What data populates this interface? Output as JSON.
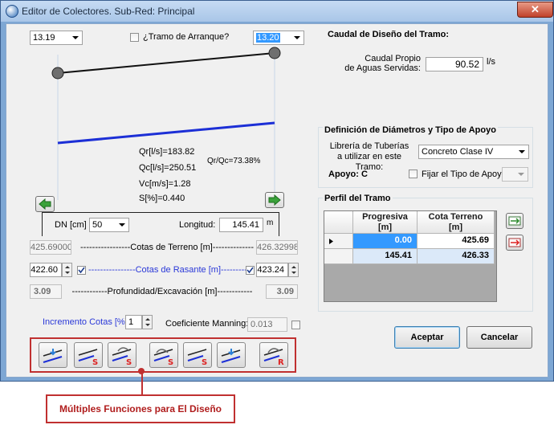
{
  "window": {
    "title": "Editor de Colectores. Sub-Red: Principal",
    "close_glyph": "✕"
  },
  "left": {
    "node_start": "13.19",
    "node_end": "13.20",
    "tramo_arranque_label": "¿Tramo de Arranque?",
    "metrics": {
      "qr": "Qr[l/s]=183.82",
      "qc": "Qc[l/s]=250.51",
      "vc": "Vc[m/s]=1.28",
      "s": "S[%]=0.440",
      "ratio": "Qr/Qc=73.38%"
    },
    "dn_label": "DN [cm]",
    "dn_value": "50",
    "longitud_label": "Longitud:",
    "longitud_value": "145.41",
    "longitud_unit": "m",
    "cotas_terreno_label": "-----------------Cotas de Terreno [m]-----------------",
    "terreno_left": "425.69000",
    "terreno_right": "426.32998",
    "cotas_rasante_label": "----------------Cotas de Rasante [m]----------------",
    "rasante_left": "422.60",
    "rasante_right": "423.24",
    "profundidad_label": "------------Profundidad/Excavación [m]------------",
    "prof_left": "3.09",
    "prof_right": "3.09",
    "incremento_label": "Incremento Cotas [%]:",
    "incremento_value": "1",
    "manning_label": "Coeficiente Manning:",
    "manning_value": "0.013"
  },
  "right": {
    "caudal_title": "Caudal de Diseño del Tramo:",
    "caudal_label_line1": "Caudal Propio",
    "caudal_label_line2": "de Aguas Servidas:",
    "caudal_value": "90.52",
    "caudal_unit": "l/s",
    "diam_title": "Definición de Diámetros y Tipo de Apoyo",
    "libreria_line1": "Librería de Tuberías",
    "libreria_line2": "a utilizar en este Tramo:",
    "libreria_value": "Concreto Clase IV",
    "apoyo_label": "Apoyo: C",
    "fijar_label": "Fijar el Tipo de Apoyo:",
    "perfil_title": "Perfil del Tramo",
    "table": {
      "headers": [
        "Progresiva\n[m]",
        "Cota Terreno\n[m]"
      ],
      "rows": [
        [
          "0.00",
          "425.69"
        ],
        [
          "145.41",
          "426.33"
        ]
      ]
    },
    "aceptar": "Aceptar",
    "cancelar": "Cancelar"
  },
  "callout": "Múltiples Funciones para El Diseño",
  "colors": {
    "pipe": "#1c2fd6",
    "accent_blue": "#2a38d8",
    "callout_red": "#c03030",
    "selected_row": "#3399ff"
  },
  "icons": [
    "arrow-left-icon",
    "arrow-right-icon",
    "add-row-icon",
    "delete-row-icon",
    "dropdown-arrow-icon"
  ]
}
